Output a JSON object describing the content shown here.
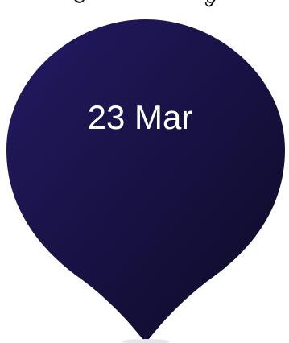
{
  "arc_label": "CCE Event Timing",
  "date_label": "23 Mar",
  "colors": {
    "pin_top": "#1e1657",
    "pin_bottom": "#0f0c2b",
    "date_text": "#ffffff",
    "arc_text": "#111111"
  }
}
